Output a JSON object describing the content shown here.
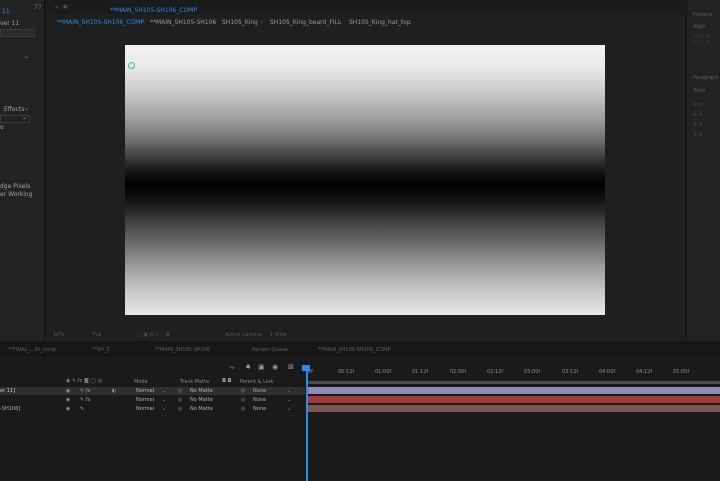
{
  "left_panel": {
    "tab_label": "11",
    "layer_name": "ver 11",
    "effects_label": "Effects",
    "edge_pixels_label": "dge Pixels",
    "working_label": "er Working"
  },
  "viewer": {
    "tab_prefix": "«",
    "tab_num": "77",
    "active_comp": "**MAIN_SH105-SH106_COMP",
    "breadcrumbs": [
      "**MAIN_SH105-SH106_COMP",
      "**MAIN_SH105-SH106",
      "SH105_King",
      "SH105_King_beard_FILL",
      "SH105_King_hat_top"
    ],
    "breadcrumb_sep": "‹",
    "footer": [
      "10%",
      "Full",
      "Active Camera",
      "1 View"
    ]
  },
  "right_panel": {
    "labels": [
      "Preview",
      "Align",
      "Paragraph",
      "Tools"
    ]
  },
  "timeline": {
    "tabs": [
      "**FINAL_...IN_comp",
      "**SH_1...",
      "**MAIN_SH105-SH106",
      "Render Queue",
      "**MAIN_SH105-SH106_COMP"
    ],
    "header": {
      "mode": "Mode",
      "track_matte": "Track Matte",
      "parent_link": "Parent & Link"
    },
    "ruler_ticks": [
      "0f",
      "00:12f",
      "01:00f",
      "01:12f",
      "02:00f",
      "02:12f",
      "03:00f",
      "03:12f",
      "04:00f",
      "04:12f",
      "05:00f"
    ],
    "layers": [
      {
        "name": "er 11]",
        "mode": "Normal",
        "matte": "No Matte",
        "parent": "None",
        "bar_color": "#8e8bb8"
      },
      {
        "name": "",
        "mode": "Normal",
        "matte": "No Matte",
        "parent": "None",
        "bar_color": "#a23b3b"
      },
      {
        "name": "-SH106]",
        "mode": "Normal",
        "matte": "No Matte",
        "parent": "None",
        "bar_color": "#7a5656"
      }
    ]
  }
}
